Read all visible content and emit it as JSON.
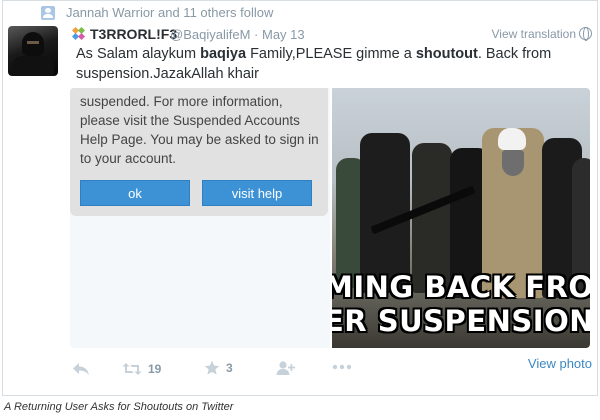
{
  "context": {
    "text": "Jannah Warrior and 11 others follow"
  },
  "tweet": {
    "display_name": "T3RRORL!F3",
    "handle": "@BaqiyalifeM",
    "separator": "·",
    "date": "May 13",
    "view_translation": "View translation",
    "text_parts": {
      "p1": "As Salam alaykum ",
      "p2": "baqiya",
      "p3": " Family,PLEASE  gimme a ",
      "p4": "shoutout",
      "p5": ". Back from suspension.JazakAllah khair"
    }
  },
  "media": {
    "dialog_text": "suspended. For more information, please visit the Suspended Accounts Help Page. You may be asked to sign in to your account.",
    "ok_label": "ok",
    "help_label": "visit help",
    "meme_line1": "MING BACK FROM",
    "meme_line2": "ER SUSPENSION LIK"
  },
  "view_photo": "View photo",
  "actions": {
    "retweets": "19",
    "favorites": "3"
  },
  "caption": "A Returning User Asks for Shoutouts on Twitter",
  "colors": {
    "link": "#3b88c3",
    "muted": "#8899a6",
    "button": "#3d92d6"
  },
  "icons": [
    "person-icon",
    "verified-icon",
    "globe-icon",
    "reply-icon",
    "retweet-icon",
    "star-icon",
    "follow-icon",
    "more-icon"
  ]
}
